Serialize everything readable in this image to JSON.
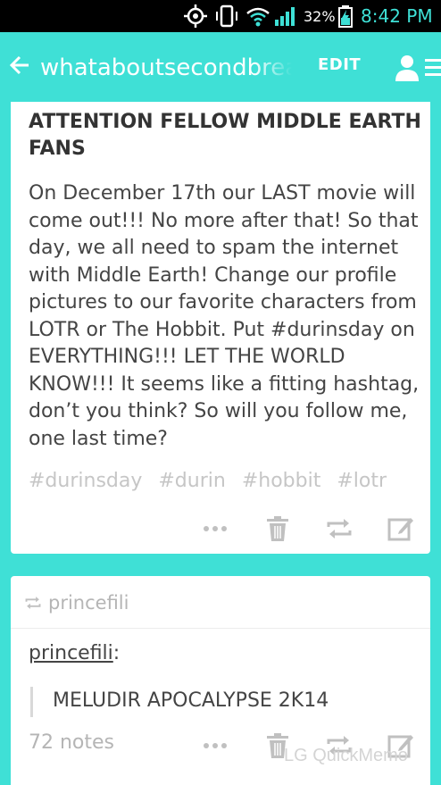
{
  "status_bar": {
    "battery": "32%",
    "time": "8:42 PM",
    "icons": [
      "gps-icon",
      "vibrate-icon",
      "wifi-icon",
      "signal-icon",
      "battery-charging-icon"
    ]
  },
  "header": {
    "blog_name": "whataboutsecondbreakfast",
    "edit_label": "EDIT",
    "icons": [
      "back-arrow-icon",
      "user-icon",
      "menu-icon"
    ],
    "background": "#3fe0d6"
  },
  "post1": {
    "title": "ATTENTION FELLOW MIDDLE EARTH FANS",
    "body": "On December 17th our LAST movie will come out!!! No more after that! So that day, we all need to spam the internet with Middle Earth! Change our profile pictures to our favorite characters from LOTR or The Hobbit. Put #durinsday on EVERYTHING!!! LET THE WORLD KNOW!!! It seems like a fitting hashtag, don’t you think? So will you follow me, one last time?",
    "tags": [
      "#durinsday",
      "#durin",
      "#hobbit",
      "#lotr"
    ],
    "actions": [
      "more-icon",
      "delete-icon",
      "reblog-icon",
      "edit-icon"
    ]
  },
  "post2": {
    "reblogged_from": "princefili",
    "author": "princefili",
    "author_suffix": ":",
    "quote": "MELUDIR APOCALYPSE 2K14",
    "notes": "72 notes",
    "actions": [
      "more-icon",
      "delete-icon",
      "reblog-icon",
      "edit-icon"
    ]
  },
  "watermark": "LG QuickMemo"
}
